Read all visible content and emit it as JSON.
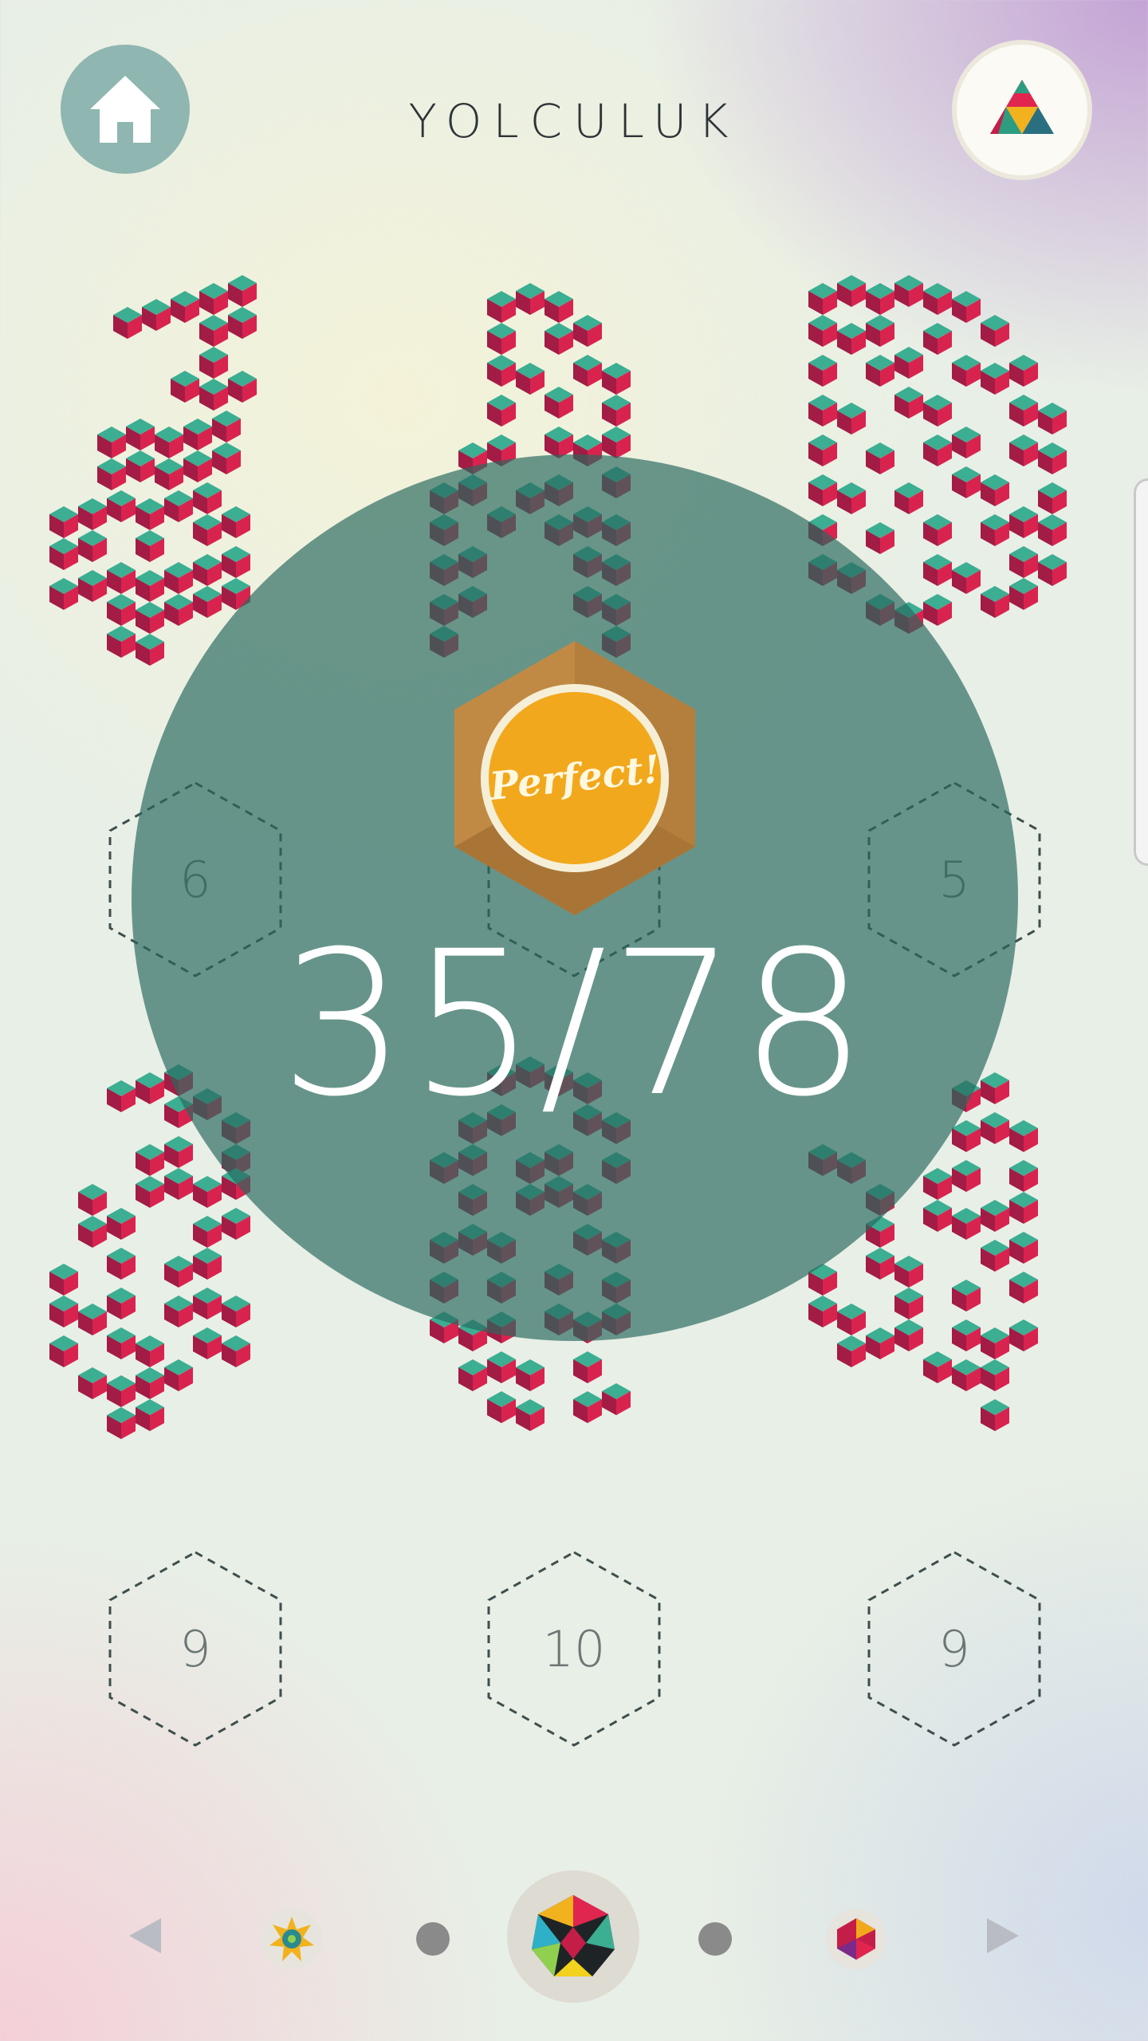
{
  "header": {
    "title": "YOLCULUK",
    "home_icon": "home-icon",
    "logo_icon": "triangle-logo-icon"
  },
  "puzzles": [
    {
      "count": "6"
    },
    {
      "count": ""
    },
    {
      "count": "5"
    },
    {
      "count": "9"
    },
    {
      "count": "10"
    },
    {
      "count": "9"
    }
  ],
  "result": {
    "badge_text": "Perfect!",
    "progress_text": "35/78"
  },
  "pager": {
    "left_arrow_icon": "chevron-left-icon",
    "right_arrow_icon": "chevron-right-icon",
    "packs": [
      "star-pack-icon",
      "dot",
      "polyhedron-pack-icon",
      "dot",
      "gem-pack-icon"
    ],
    "selected_index": 2
  },
  "colors": {
    "cube_top": "#3cae92",
    "cube_left": "#a21c45",
    "cube_right": "#d9234f",
    "overlay": "#28695f",
    "badge_gold": "#f2a81d"
  }
}
